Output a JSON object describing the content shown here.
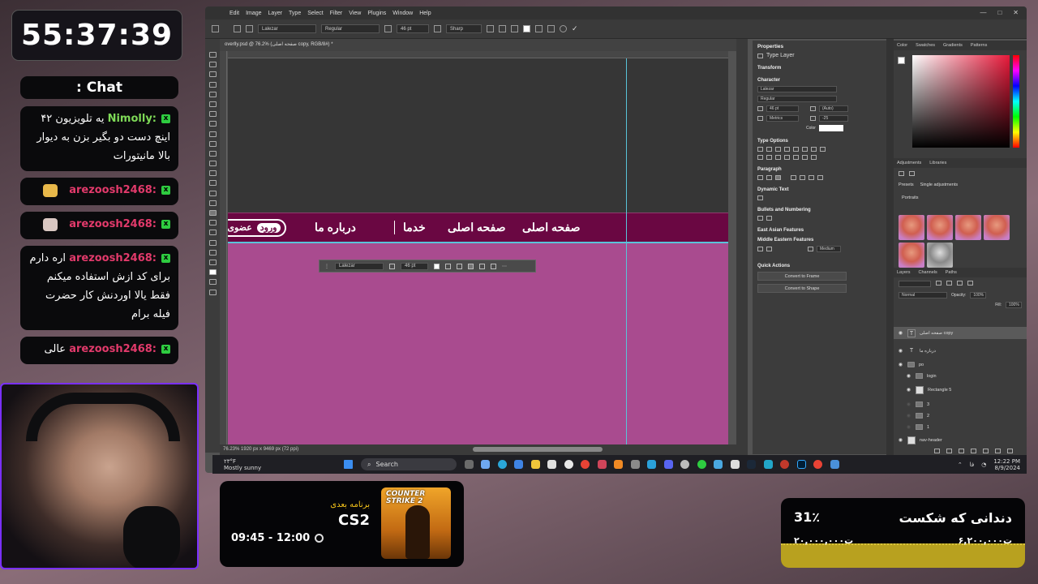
{
  "timer": "55:37:39",
  "chat": {
    "title": ": Chat",
    "messages": [
      {
        "user": ":Nimolly",
        "user_color": "#7ed957",
        "text": "یه تلویزیون ۴۲ اینچ دست دو بگیر بزن به دیوار بالا مانیتورات"
      },
      {
        "user": ":arezoosh2468",
        "user_color": "#e23a6b",
        "text": ""
      },
      {
        "user": ":arezoosh2468",
        "user_color": "#e23a6b",
        "text": ""
      },
      {
        "user": ":arezoosh2468",
        "user_color": "#e23a6b",
        "text": "اره دارم برای کد ازش استفاده میکنم فقط یالا اوردنش کار حضرت فیله برام"
      },
      {
        "user": ":arezoosh2468",
        "user_color": "#e23a6b",
        "text": "عالی"
      }
    ],
    "badge": "x"
  },
  "photoshop": {
    "menu": [
      "Edit",
      "Image",
      "Layer",
      "Type",
      "Select",
      "Filter",
      "View",
      "Plugins",
      "Window",
      "Help"
    ],
    "options": {
      "font": "Lalezar",
      "style": "Regular",
      "size": "46 pt",
      "antialias": "Sharp"
    },
    "doc_tab": "overlly.psd @ 76.2% (صفحه اصلی copy, RGB/8#) *",
    "status": "76.23%      1920 px x 9469 px (72 ppi)",
    "nav_items": {
      "item1": "صفحه اصلی",
      "item2": "صفحه اصلی",
      "item3": "خدما",
      "item4": "درباره ما",
      "login": "ورود",
      "login_tag": "عضوی"
    },
    "float_bar": {
      "font": "Lalezar",
      "size": "46 pt"
    },
    "properties": {
      "title": "Properties",
      "type_layer": "Type Layer",
      "transform": "Transform",
      "character": "Character",
      "font": "Lalezar",
      "style": "Regular",
      "size": "46 pt",
      "leading": "(Auto)",
      "kerning": "Metrics",
      "tracking": "-25",
      "color_label": "Color",
      "type_options": "Type Options",
      "paragraph": "Paragraph",
      "dynamic_text": "Dynamic Text",
      "bullets": "Bullets and Numbering",
      "east_asian": "East Asian Features",
      "middle_eastern": "Middle Eastern Features",
      "direction": "Medium",
      "quick_actions": "Quick Actions",
      "convert_frame": "Convert to Frame",
      "convert_shape": "Convert to Shape"
    },
    "color_panel_tabs": [
      "Color",
      "Swatches",
      "Gradients",
      "Patterns"
    ],
    "adjustments": {
      "tabs": [
        "Adjustments",
        "Libraries"
      ],
      "presets": "Presets",
      "single": "Single adjustments",
      "portraits": "Portraits"
    },
    "layers": {
      "tabs": [
        "Layers",
        "Channels",
        "Paths"
      ],
      "blend": "Normal",
      "opacity_label": "Opacity:",
      "opacity": "100%",
      "fill_label": "Fill:",
      "fill": "100%",
      "rows": [
        {
          "name": "صفحه اصلی copy",
          "kind": "text",
          "selected": true
        },
        {
          "name": "درباره ما",
          "kind": "text",
          "selected": false
        },
        {
          "name": "po",
          "kind": "folder",
          "selected": false
        },
        {
          "name": "login",
          "kind": "folder",
          "selected": false
        },
        {
          "name": "Rectangle 5",
          "kind": "shape",
          "selected": false
        },
        {
          "name": "3",
          "kind": "folder",
          "selected": false
        },
        {
          "name": "2",
          "kind": "folder",
          "selected": false
        },
        {
          "name": "1",
          "kind": "folder",
          "selected": false
        },
        {
          "name": "nav-header",
          "kind": "shape",
          "selected": false
        }
      ]
    }
  },
  "taskbar": {
    "temp": "۲۳°F",
    "weather": "Mostly sunny",
    "search": "Search",
    "lang": "فا",
    "time": "12:22 PM",
    "date": "8/9/2024"
  },
  "next_program": {
    "label": "برنامه بعدی",
    "name": "CS2",
    "time": "09:45 - 12:00",
    "cover_title": "COUNTER STRIKE 2"
  },
  "goal": {
    "title": "دندانی که شکست",
    "percent": "31٪",
    "target": "۶,۲۰۰,۰۰۰ت",
    "current": "۲۰,۰۰۰,۰۰۰ت",
    "progress_fraction": 0.31
  }
}
